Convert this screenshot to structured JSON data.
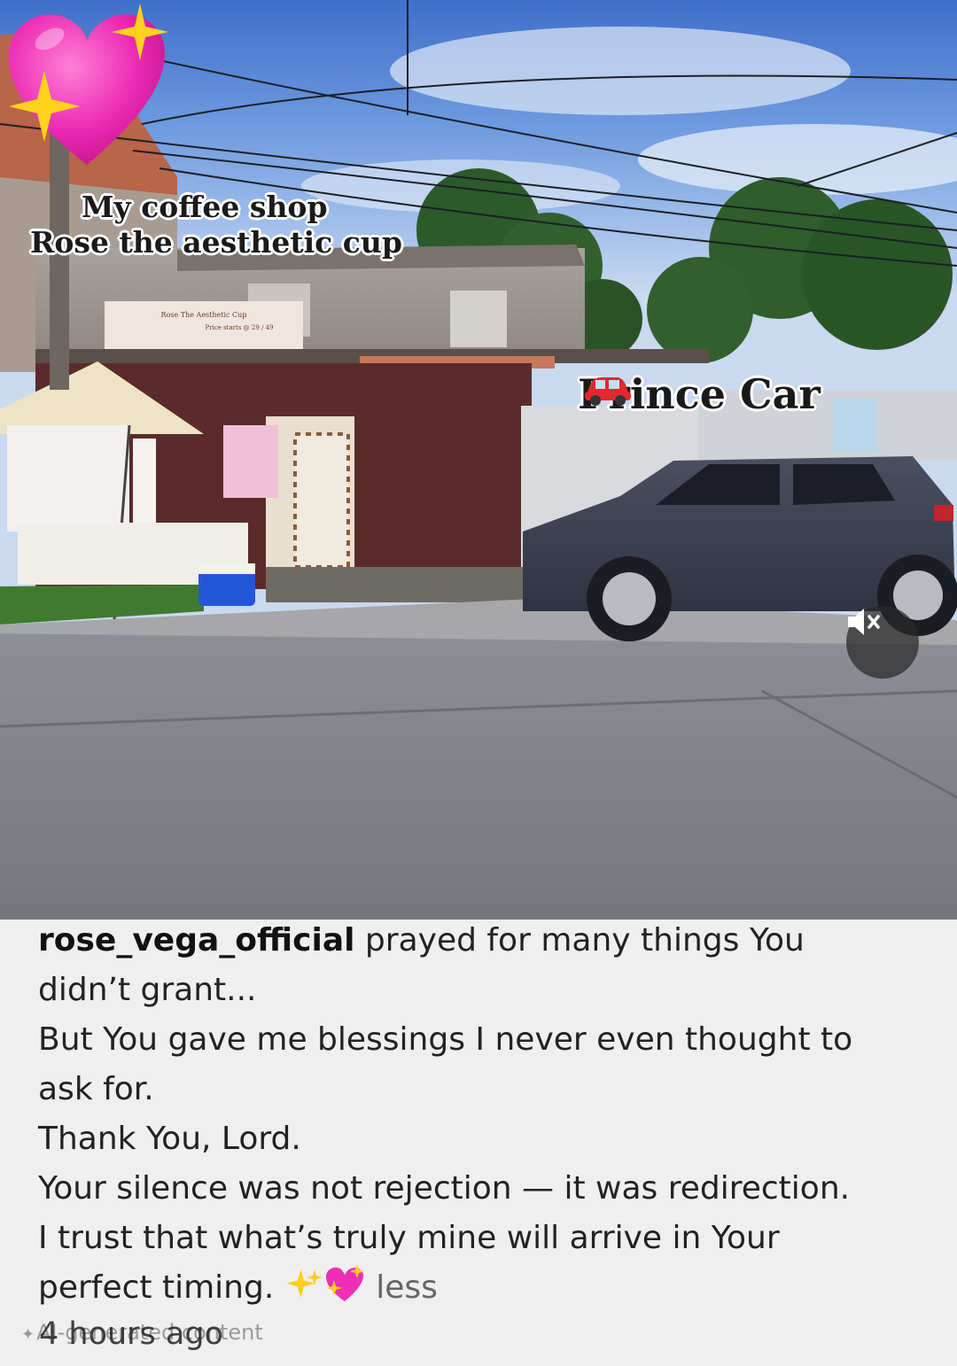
{
  "photo": {
    "coffee_shop_label_line1": "My coffee shop",
    "coffee_shop_label_line2": "Rose the aesthetic cup",
    "car_label": "Prince Car",
    "sign_title": "Rose The Aesthetic Cup",
    "sign_price": "Price starts @ 29 / 49",
    "mute_icon": "speaker-muted-icon",
    "sticker_icon": "sparkling-heart-icon",
    "car_icon": "red-car-icon"
  },
  "post": {
    "username": "rose_vega_official",
    "caption_lines": [
      "prayed for many things You",
      "didn’t grant...",
      "But You gave me blessings I never even thought to",
      "ask for.",
      "Thank You, Lord.",
      "Your silence was not rejection — it was redirection.",
      "I trust that what’s truly mine will arrive in Your",
      "perfect timing."
    ],
    "less_label": "less",
    "ai_label": "AI-generated content",
    "timestamp": "4 hours ago"
  }
}
